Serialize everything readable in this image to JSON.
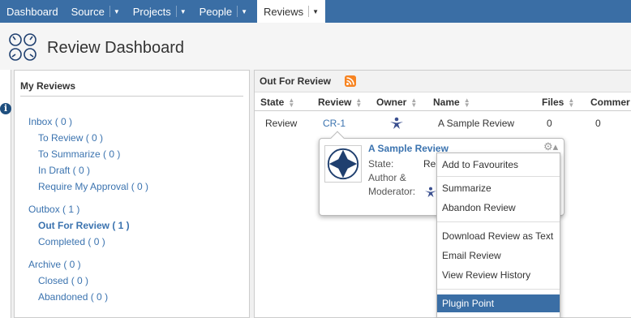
{
  "nav": {
    "items": [
      {
        "label": "Dashboard",
        "dropdown": false,
        "active": false
      },
      {
        "label": "Source",
        "dropdown": true,
        "active": false
      },
      {
        "label": "Projects",
        "dropdown": true,
        "active": false
      },
      {
        "label": "People",
        "dropdown": true,
        "active": false
      },
      {
        "label": "Reviews",
        "dropdown": true,
        "active": true
      }
    ],
    "dropdown_glyph": "▼"
  },
  "header": {
    "title": "Review Dashboard",
    "icon": "dashboard-gauges-icon"
  },
  "info_icon": {
    "glyph": "i"
  },
  "my_reviews": {
    "title": "My Reviews",
    "inbox": "Inbox ( 0 )",
    "to_review": "To Review ( 0 )",
    "to_summarize": "To Summarize ( 0 )",
    "in_draft": "In Draft ( 0 )",
    "require_approval": "Require My Approval ( 0 )",
    "outbox": "Outbox ( 1 )",
    "out_for_review": "Out For Review ( 1 )",
    "completed": "Completed ( 0 )",
    "archive": "Archive ( 0 )",
    "closed": "Closed ( 0 )",
    "abandoned": "Abandoned ( 0 )"
  },
  "out_for_review": {
    "title": "Out For Review",
    "columns": [
      "State",
      "Review",
      "Owner",
      "Name",
      "Files",
      "Commer"
    ],
    "sort_glyph": "▲▼",
    "row": {
      "state": "Review",
      "review": "CR-1",
      "owner_icon": "person-icon",
      "name": "A Sample Review",
      "files": "0",
      "comments": "0"
    }
  },
  "hovercard": {
    "title": "A Sample Review",
    "state_label": "State:",
    "state_value": "Re",
    "author_label": "Author &",
    "moderator_label": "Moderator:",
    "gear_glyph": "⚙▴"
  },
  "menu": {
    "items": [
      "Add to Favourites",
      "Summarize",
      "Abandon Review",
      "Download Review as Text",
      "Email Review",
      "View Review History",
      "Plugin Point"
    ],
    "highlighted": "Plugin Point"
  },
  "colors": {
    "nav_bg": "#3a6ea5",
    "link": "#3b73af",
    "rss": "#f78422",
    "highlight": "#3a6ea5"
  }
}
